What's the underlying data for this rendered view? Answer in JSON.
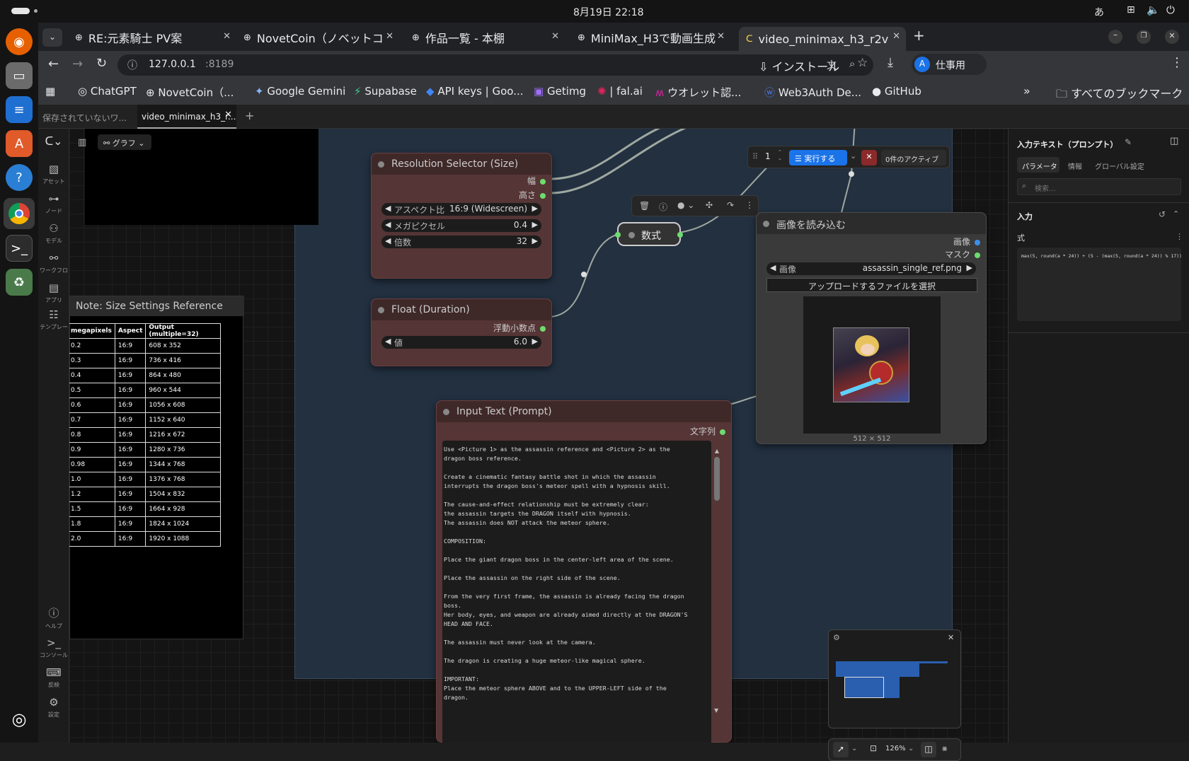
{
  "system": {
    "clock": "8月19日  22:18",
    "ime": "あ"
  },
  "tabs": [
    {
      "title": "RE:元素騎士 PV案"
    },
    {
      "title": "NovetCoin（ノベットコ"
    },
    {
      "title": "作品一覧 - 本棚"
    },
    {
      "title": "MiniMax_H3で動画生成"
    },
    {
      "title": "video_minimax_h3_r2v"
    }
  ],
  "address": {
    "url_host": "127.0.0.1",
    "url_port": ":8189",
    "install": "インストール",
    "profile": "仕事用",
    "profile_initial": "A"
  },
  "bookmarks": [
    "ChatGPT",
    "NovetCoin（...",
    "Google Gemini",
    "Supabase",
    "API keys | Goo...",
    "Getimg",
    "| fal.ai",
    "ウオレット認...",
    "Web3Auth De...",
    "GitHub",
    "すべてのブックマーク"
  ],
  "workflow_tabs": [
    "保存されていないワ...",
    "video_minimax_h3_r..."
  ],
  "graph_label": "グラフ",
  "left_nav": [
    "アセット",
    "ノード",
    "モデル",
    "ワークフロ",
    "アプリ",
    "テンプレー",
    "ヘルプ",
    "コンソール",
    "反映",
    "設定"
  ],
  "resolution_node": {
    "title": "Resolution Selector (Size)",
    "out_width": "幅",
    "out_height": "高さ",
    "w1_label": "アスペクト比",
    "w1_value": "16:9 (Widescreen)",
    "w2_label": "メガピクセル",
    "w2_value": "0.4",
    "w3_label": "倍数",
    "w3_value": "32"
  },
  "float_node": {
    "title": "Float (Duration)",
    "out": "浮動小数点",
    "w_label": "値",
    "w_value": "6.0"
  },
  "formula_node": {
    "title": "数式"
  },
  "image_node": {
    "title": "画像を読み込む",
    "out_image": "画像",
    "out_mask": "マスク",
    "w_label": "画像",
    "w_value": "assassin_single_ref.png",
    "upload": "アップロードするファイルを選択",
    "size": "512 × 512"
  },
  "prompt_node": {
    "title": "Input Text (Prompt)",
    "out": "文字列",
    "text": "Use <Picture 1> as the assassin reference and <Picture 2> as the dragon boss reference.\n\nCreate a cinematic fantasy battle shot in which the assassin interrupts the dragon boss's meteor spell with a hypnosis skill.\n\nThe cause-and-effect relationship must be extremely clear:\nthe assassin targets the DRAGON itself with hypnosis.\nThe assassin does NOT attack the meteor sphere.\n\nCOMPOSITION:\n\nPlace the giant dragon boss in the center-left area of the scene.\n\nPlace the assassin on the right side of the scene.\n\nFrom the very first frame, the assassin is already facing the dragon boss.\nHer body, eyes, and weapon are already aimed directly at the DRAGON'S HEAD AND FACE.\n\nThe assassin must never look at the camera.\n\nThe dragon is creating a huge meteor-like magical sphere.\n\nIMPORTANT:\nPlace the meteor sphere ABOVE and to the UPPER-LEFT side of the dragon.\n\nThe meteor sphere must NOT be positioned between the assassin and the dragon.\n\nKeep a clear visual line from the assassin's weapon directly toward the"
  },
  "note_node": {
    "title": "Note: Size Settings Reference",
    "headers": [
      "megapixels",
      "Aspect",
      "Output (multiple=32)"
    ],
    "rows": [
      [
        "0.2",
        "16:9",
        "608 x 352"
      ],
      [
        "0.3",
        "16:9",
        "736 x 416"
      ],
      [
        "0.4",
        "16:9",
        "864 x 480"
      ],
      [
        "0.5",
        "16:9",
        "960 x 544"
      ],
      [
        "0.6",
        "16:9",
        "1056 x 608"
      ],
      [
        "0.7",
        "16:9",
        "1152 x 640"
      ],
      [
        "0.8",
        "16:9",
        "1216 x 672"
      ],
      [
        "0.9",
        "16:9",
        "1280 x 736"
      ],
      [
        "0.98",
        "16:9",
        "1344 x 768"
      ],
      [
        "1.0",
        "16:9",
        "1376 x 768"
      ],
      [
        "1.2",
        "16:9",
        "1504 x 832"
      ],
      [
        "1.5",
        "16:9",
        "1664 x 928"
      ],
      [
        "1.8",
        "16:9",
        "1824 x 1024"
      ],
      [
        "2.0",
        "16:9",
        "1920 x 1088"
      ]
    ]
  },
  "queue": {
    "count": "1",
    "run": "実行する",
    "active": "0件のアクティブ"
  },
  "right_panel": {
    "title": "入力テキスト（プロンプト）",
    "tabs": [
      "パラメータ",
      "情報",
      "グローバル設定"
    ],
    "search_placeholder": "検索...",
    "section": "入力",
    "field_label": "式",
    "formula": "max(5, round(a * 24)) + (5 - (max(5, round(a * 24)) % 17)) % 17"
  },
  "zoom": "126%",
  "colors": {
    "accent": "#1a73e8",
    "node_red": "#553535",
    "link_green": "#6ddc6d",
    "link_blue": "#3b8fe8"
  }
}
